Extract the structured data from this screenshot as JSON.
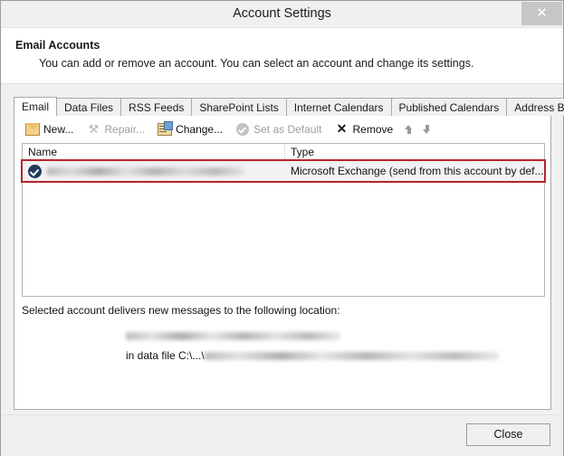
{
  "window": {
    "title": "Account Settings",
    "close_icon": "close-icon",
    "close_glyph": "✕"
  },
  "header": {
    "title": "Email Accounts",
    "description": "You can add or remove an account. You can select an account and change its settings."
  },
  "tabs": [
    {
      "label": "Email",
      "active": true
    },
    {
      "label": "Data Files",
      "active": false
    },
    {
      "label": "RSS Feeds",
      "active": false
    },
    {
      "label": "SharePoint Lists",
      "active": false
    },
    {
      "label": "Internet Calendars",
      "active": false
    },
    {
      "label": "Published Calendars",
      "active": false
    },
    {
      "label": "Address Books",
      "active": false
    }
  ],
  "toolbar": {
    "items": [
      {
        "label": "New...",
        "icon": "new-account-icon",
        "disabled": false
      },
      {
        "label": "Repair...",
        "icon": "repair-tools-icon",
        "disabled": true
      },
      {
        "label": "Change...",
        "icon": "change-settings-icon",
        "disabled": false
      },
      {
        "label": "Set as Default",
        "icon": "set-default-check-icon",
        "disabled": true
      },
      {
        "label": "Remove",
        "icon": "remove-x-icon",
        "disabled": false
      }
    ],
    "move_up_icon": "arrow-up-icon",
    "move_down_icon": "arrow-down-icon"
  },
  "accounts_list": {
    "columns": [
      "Name",
      "Type"
    ],
    "rows": [
      {
        "name": "",
        "name_redacted": true,
        "name_redaction_width": 218,
        "type": "Microsoft Exchange (send from this account by def...",
        "default_badge_icon": "default-account-check-icon",
        "selected": true
      }
    ]
  },
  "delivery": {
    "label": "Selected account delivers new messages to the following location:",
    "location_redacted": true,
    "location_redaction_width": 237,
    "data_file_prefix": "in data file C:\\...\\",
    "data_file_redacted": true,
    "data_file_redaction_width": 325
  },
  "footer": {
    "close_label": "Close"
  },
  "colors": {
    "annotation_red": "#b5252c",
    "default_badge": "#253b5e",
    "window_bg": "#f0f0f0",
    "panel_bg": "#ffffff"
  }
}
